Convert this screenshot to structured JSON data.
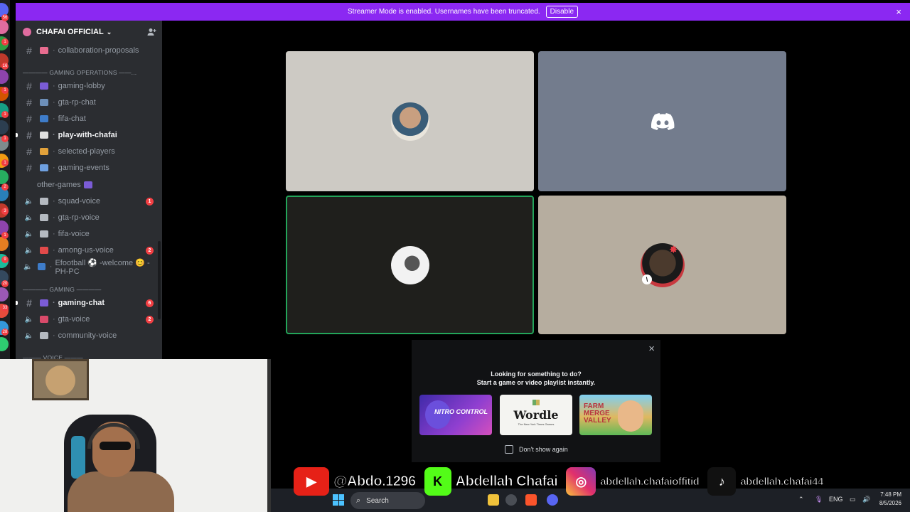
{
  "banner": {
    "message": "Streamer Mode is enabled. Usernames have been truncated.",
    "disable_label": "Disable",
    "close_icon": "×",
    "color": "#8b28f2"
  },
  "server": {
    "name": "CHAFAI OFFICIAL",
    "chevron": "⌄",
    "invite_icon": "person-add-icon"
  },
  "channels": [
    {
      "type": "text",
      "emoji_color": "#e86c8f",
      "name": "collaboration-proposals",
      "active": false,
      "badge": ""
    },
    {
      "type": "category",
      "name": "———— GAMING OPERATIONS ——..."
    },
    {
      "type": "text",
      "emoji_color": "#7b5cd6",
      "name": "gaming-lobby",
      "active": false,
      "badge": ""
    },
    {
      "type": "text",
      "emoji_color": "#6d8fb8",
      "name": "gta-rp-chat",
      "active": false,
      "badge": ""
    },
    {
      "type": "text",
      "emoji_color": "#3e7cc9",
      "name": "fifa-chat",
      "active": false,
      "badge": ""
    },
    {
      "type": "text",
      "emoji_color": "#e0e0e0",
      "name": "play-with-chafai",
      "active": true,
      "badge": ""
    },
    {
      "type": "text",
      "emoji_color": "#e2a23b",
      "name": "selected-players",
      "active": false,
      "badge": ""
    },
    {
      "type": "text",
      "emoji_color": "#6fa0e0",
      "name": "gaming-events",
      "active": false,
      "badge": ""
    },
    {
      "type": "text-plain",
      "name": "other-games",
      "emoji_color": "#7b5cd6",
      "active": false,
      "badge": ""
    },
    {
      "type": "voice",
      "emoji_color": "#b5bac1",
      "name": "squad-voice",
      "active": false,
      "badge": "1"
    },
    {
      "type": "voice",
      "emoji_color": "#b5bac1",
      "name": "gta-rp-voice",
      "active": false,
      "badge": ""
    },
    {
      "type": "voice",
      "emoji_color": "#b5bac1",
      "name": "fifa-voice",
      "active": false,
      "badge": ""
    },
    {
      "type": "voice",
      "emoji_color": "#e24a4a",
      "name": "among-us-voice",
      "active": false,
      "badge": "2"
    },
    {
      "type": "voice",
      "emoji_color": "#3e7cc9",
      "name": "Efootball ⚽ -welcome 😊 -PH-PC",
      "active": false,
      "badge": ""
    },
    {
      "type": "category",
      "name": "———— GAMING ————"
    },
    {
      "type": "text",
      "emoji_color": "#7b5cd6",
      "name": "gaming-chat",
      "active": true,
      "badge": "6"
    },
    {
      "type": "voice",
      "emoji_color": "#d94a6a",
      "name": "gta-voice",
      "active": false,
      "badge": "2"
    },
    {
      "type": "voice",
      "emoji_color": "#b5bac1",
      "name": "community-voice",
      "active": false,
      "badge": ""
    },
    {
      "type": "category",
      "name": "——— VOICE ———"
    }
  ],
  "rail_badges": [
    "56",
    "1",
    "16",
    "1",
    "1",
    "1",
    "1",
    "2",
    "3",
    "1",
    "9",
    "20",
    "33",
    "28"
  ],
  "activity": {
    "line1": "Looking for something to do?",
    "line2": "Start a game or video playlist instantly.",
    "games": [
      {
        "name": "NITRO CONTROL"
      },
      {
        "name": "Wordle",
        "subtitle": "The New York Times Games"
      },
      {
        "name": "FARM MERGE VALLEY"
      }
    ],
    "dont_show": "Don't show again",
    "close_icon": "×"
  },
  "social": {
    "youtube": "@Abdo.1296",
    "kick": "Abdellah Chafai",
    "instagram": "abdellah.chafaioffitid",
    "tiktok": "abdellah.chafai44"
  },
  "taskbar": {
    "search": "Search",
    "lang": "ENG",
    "time": "7:48 PM",
    "date": "8/5/2026"
  }
}
